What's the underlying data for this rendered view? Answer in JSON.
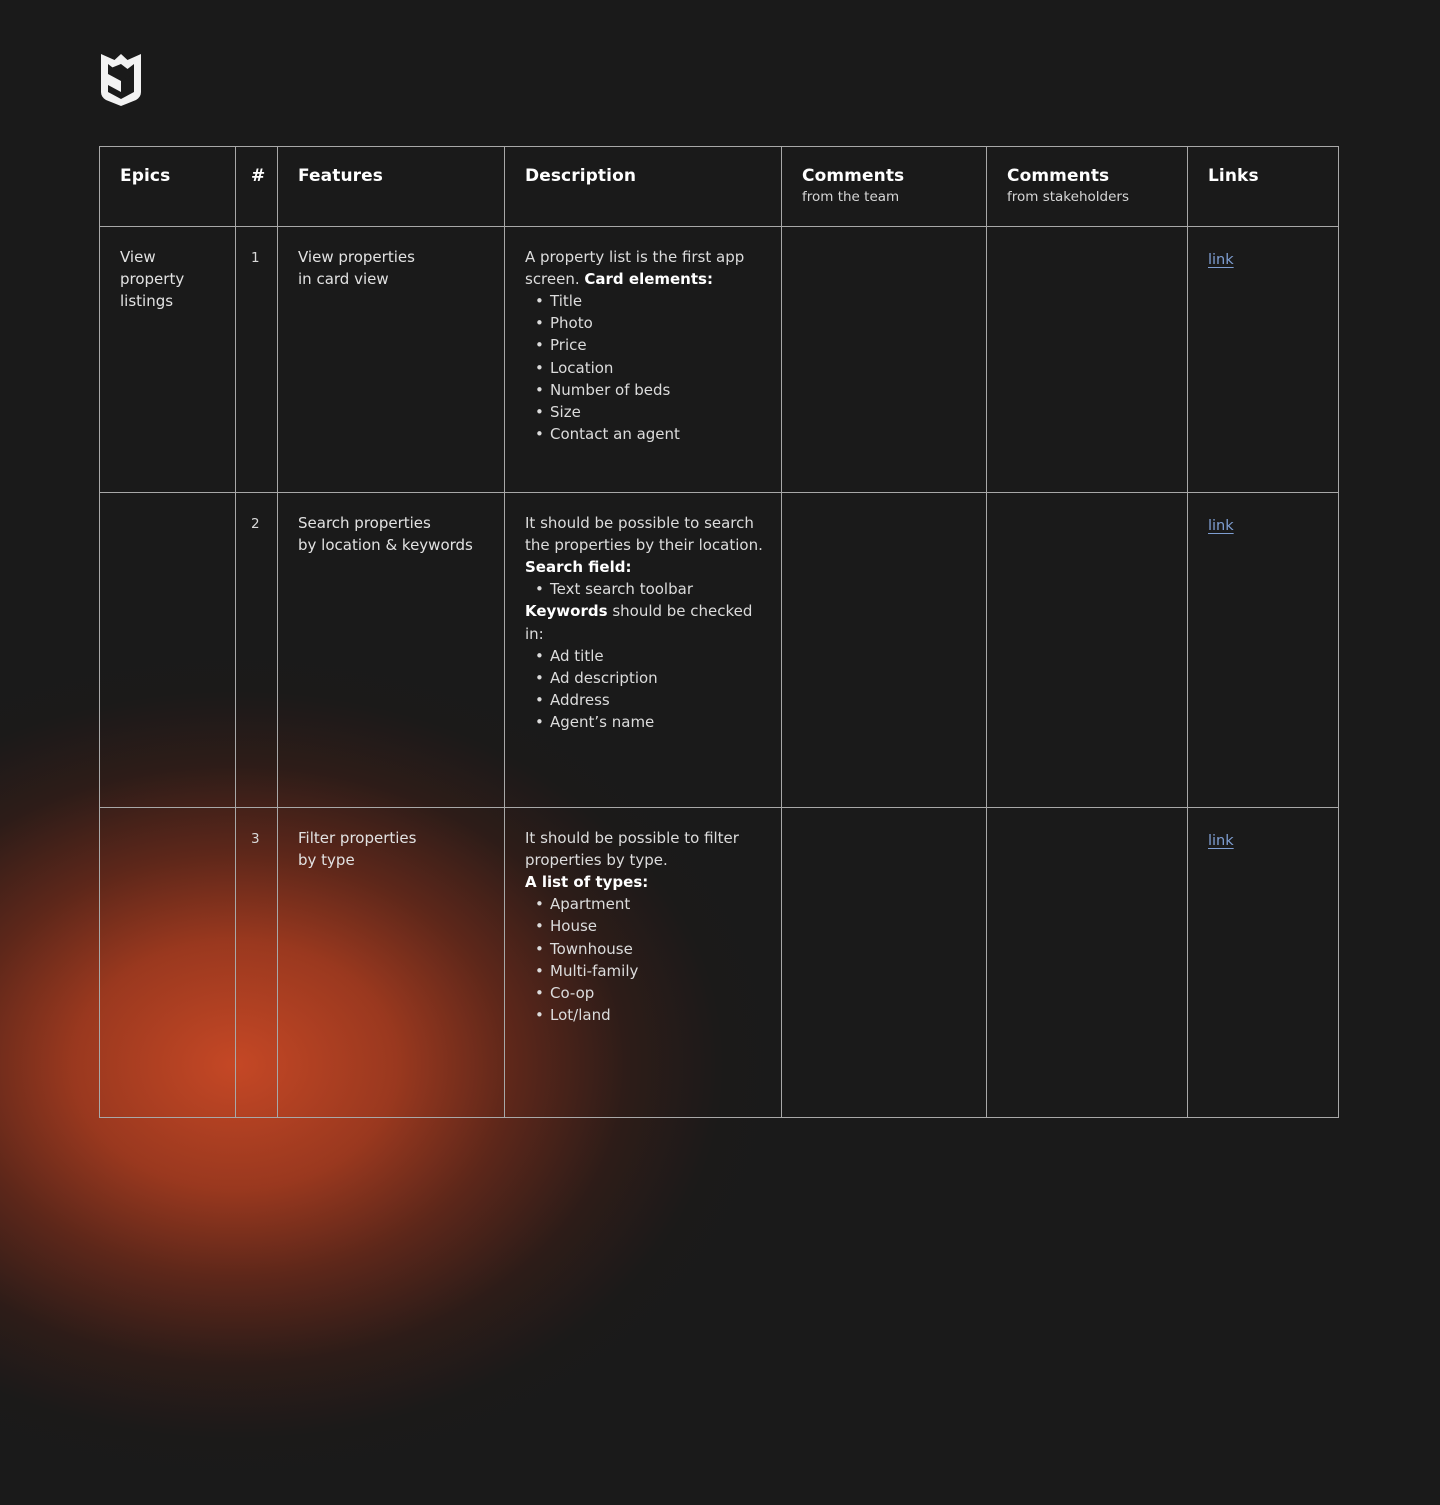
{
  "logo": {
    "name": "ms-monogram-logo",
    "alt": "MS shield monogram"
  },
  "table": {
    "headers": [
      {
        "title": "Epics",
        "sub": ""
      },
      {
        "title": "#",
        "sub": ""
      },
      {
        "title": "Features",
        "sub": ""
      },
      {
        "title": "Description",
        "sub": ""
      },
      {
        "title": "Comments",
        "sub": "from the team"
      },
      {
        "title": "Comments",
        "sub": "from stakeholders"
      },
      {
        "title": "Links",
        "sub": ""
      }
    ],
    "rows": [
      {
        "epic_lines": [
          "View",
          "property",
          "listings"
        ],
        "number": "1",
        "feature_lines": [
          "View properties",
          "in card view"
        ],
        "description": {
          "intro_plain": "A property list is the first app screen. ",
          "intro_bold": "Card elements:",
          "bullets": [
            "Title",
            "Photo",
            "Price",
            "Location",
            "Number of beds",
            "Size",
            "Contact an agent"
          ]
        },
        "comments_team": "",
        "comments_stakeholders": "",
        "link_label": "link"
      },
      {
        "epic_lines": [],
        "number": "2",
        "feature_lines": [
          "Search properties",
          "by location & keywords"
        ],
        "description": {
          "intro_plain": "It should be possible to search the properties by their location.",
          "section1_bold": "Search field:",
          "bullets1": [
            "Text search toolbar"
          ],
          "section2_bold": "Keywords",
          "section2_plain": " should be checked in:",
          "bullets2": [
            "Ad title",
            "Ad description",
            "Address",
            "Agent’s name"
          ]
        },
        "comments_team": "",
        "comments_stakeholders": "",
        "link_label": "link"
      },
      {
        "epic_lines": [],
        "number": "3",
        "feature_lines": [
          "Filter properties",
          "by type"
        ],
        "description": {
          "intro_plain": "It should be possible to filter properties by type.",
          "intro_bold": "A list of types:",
          "bullets": [
            "Apartment",
            "House",
            "Townhouse",
            "Multi-family",
            "Co-op",
            "Lot/land"
          ]
        },
        "comments_team": "",
        "comments_stakeholders": "",
        "link_label": "link"
      }
    ]
  },
  "colors": {
    "background": "#1a1a1a",
    "border": "#a8a8a8",
    "text": "#dedede",
    "text_bold": "#ffffff",
    "link": "#7e9ed2",
    "glow": "#ce4a26"
  }
}
